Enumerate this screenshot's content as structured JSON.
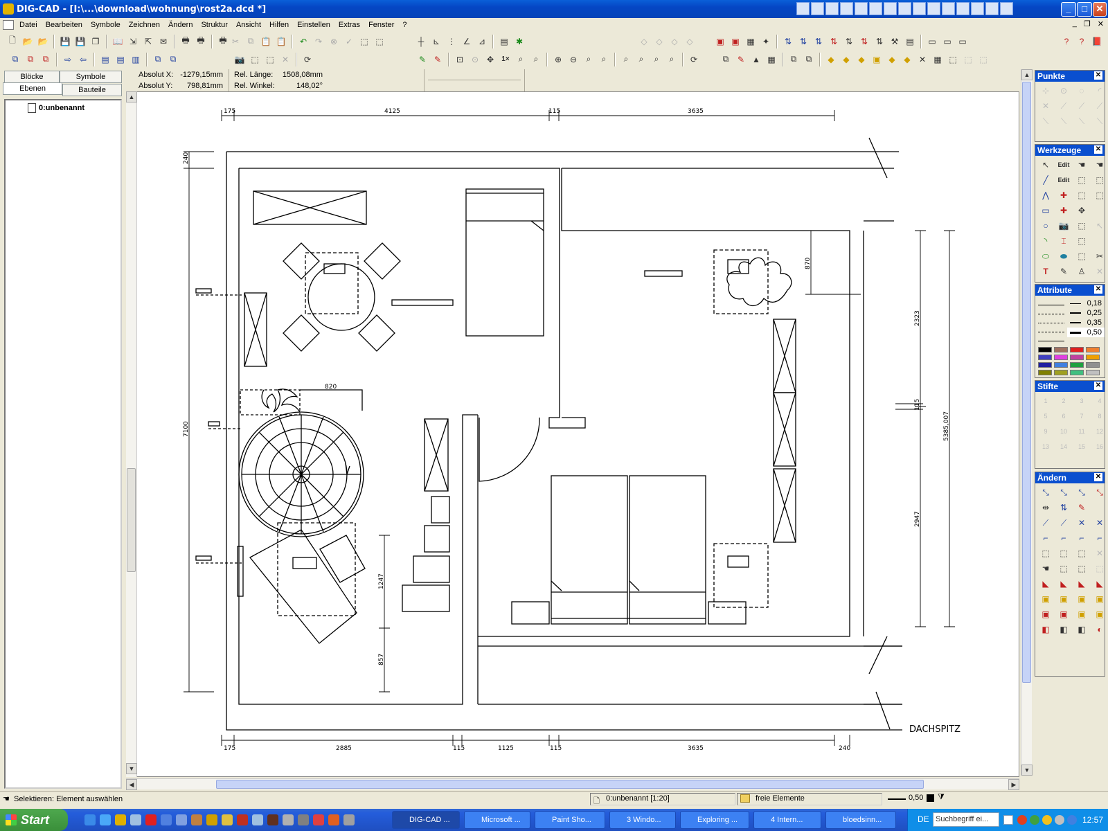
{
  "window": {
    "title": "DIG-CAD - [I:\\...\\download\\wohnung\\rost2a.dcd *]"
  },
  "menu": [
    "Datei",
    "Bearbeiten",
    "Symbole",
    "Zeichnen",
    "Ändern",
    "Struktur",
    "Ansicht",
    "Hilfen",
    "Einstellen",
    "Extras",
    "Fenster",
    "?"
  ],
  "left_tabs": [
    "Blöcke",
    "Symbole",
    "Ebenen",
    "Bauteile"
  ],
  "layer_tree": {
    "item": "0:unbenannt"
  },
  "coords": {
    "abs_x_label": "Absolut X:",
    "abs_x": "-1279,15mm",
    "abs_y_label": "Absolut Y:",
    "abs_y": "798,81mm",
    "rel_len_label": "Rel. Länge:",
    "rel_len": "1508,08mm",
    "rel_ang_label": "Rel. Winkel:",
    "rel_ang": "148,02°"
  },
  "palettes": {
    "punkte": "Punkte",
    "werkzeuge": "Werkzeuge",
    "attribute": "Attribute",
    "stifte": "Stifte",
    "aendern": "Ändern"
  },
  "line_widths": [
    "0,18",
    "0,25",
    "0,35",
    "0,50"
  ],
  "pen_labels": [
    "1",
    "2",
    "3",
    "4",
    "5",
    "6",
    "7",
    "8",
    "9",
    "10",
    "11",
    "12",
    "13",
    "14",
    "15",
    "16"
  ],
  "swatch_colors": [
    "#000000",
    "#a07060",
    "#e02020",
    "#f08030",
    "#4040c0",
    "#e040e0",
    "#c040a0",
    "#f0a000",
    "#2020a0",
    "#4080e0",
    "#20a040",
    "#909090",
    "#808000",
    "#a0a020",
    "#40c080",
    "#c0c0c0"
  ],
  "drawing": {
    "dims_top": [
      "175",
      "4125",
      "115",
      "3635"
    ],
    "dims_bottom": [
      "175",
      "2885",
      "115",
      "1125",
      "115",
      "3635",
      "240"
    ],
    "dim_240_left": "240",
    "dim_7100": "7100",
    "dim_820": "820",
    "dim_1247": "1247",
    "dim_857": "857",
    "dim_870": "870",
    "dim_2323": "2323",
    "dim_115_right": "115",
    "dim_5385": "5385,007",
    "dim_2947": "2947",
    "label": "DACHSPITZ"
  },
  "status": {
    "message": "Selektieren: Element auswählen",
    "layer": "0:unbenannt [1:20]",
    "group": "freie Elemente",
    "line_width": "0,50"
  },
  "taskbar": {
    "start": "Start",
    "tasks": [
      "DIG-CAD ...",
      "Microsoft ...",
      "Paint Sho...",
      "3 Windo...",
      "Exploring ...",
      "4 Intern...",
      "bloedsinn..."
    ],
    "lang": "DE",
    "search_placeholder": "Suchbegriff ei...",
    "clock": "12:57"
  }
}
